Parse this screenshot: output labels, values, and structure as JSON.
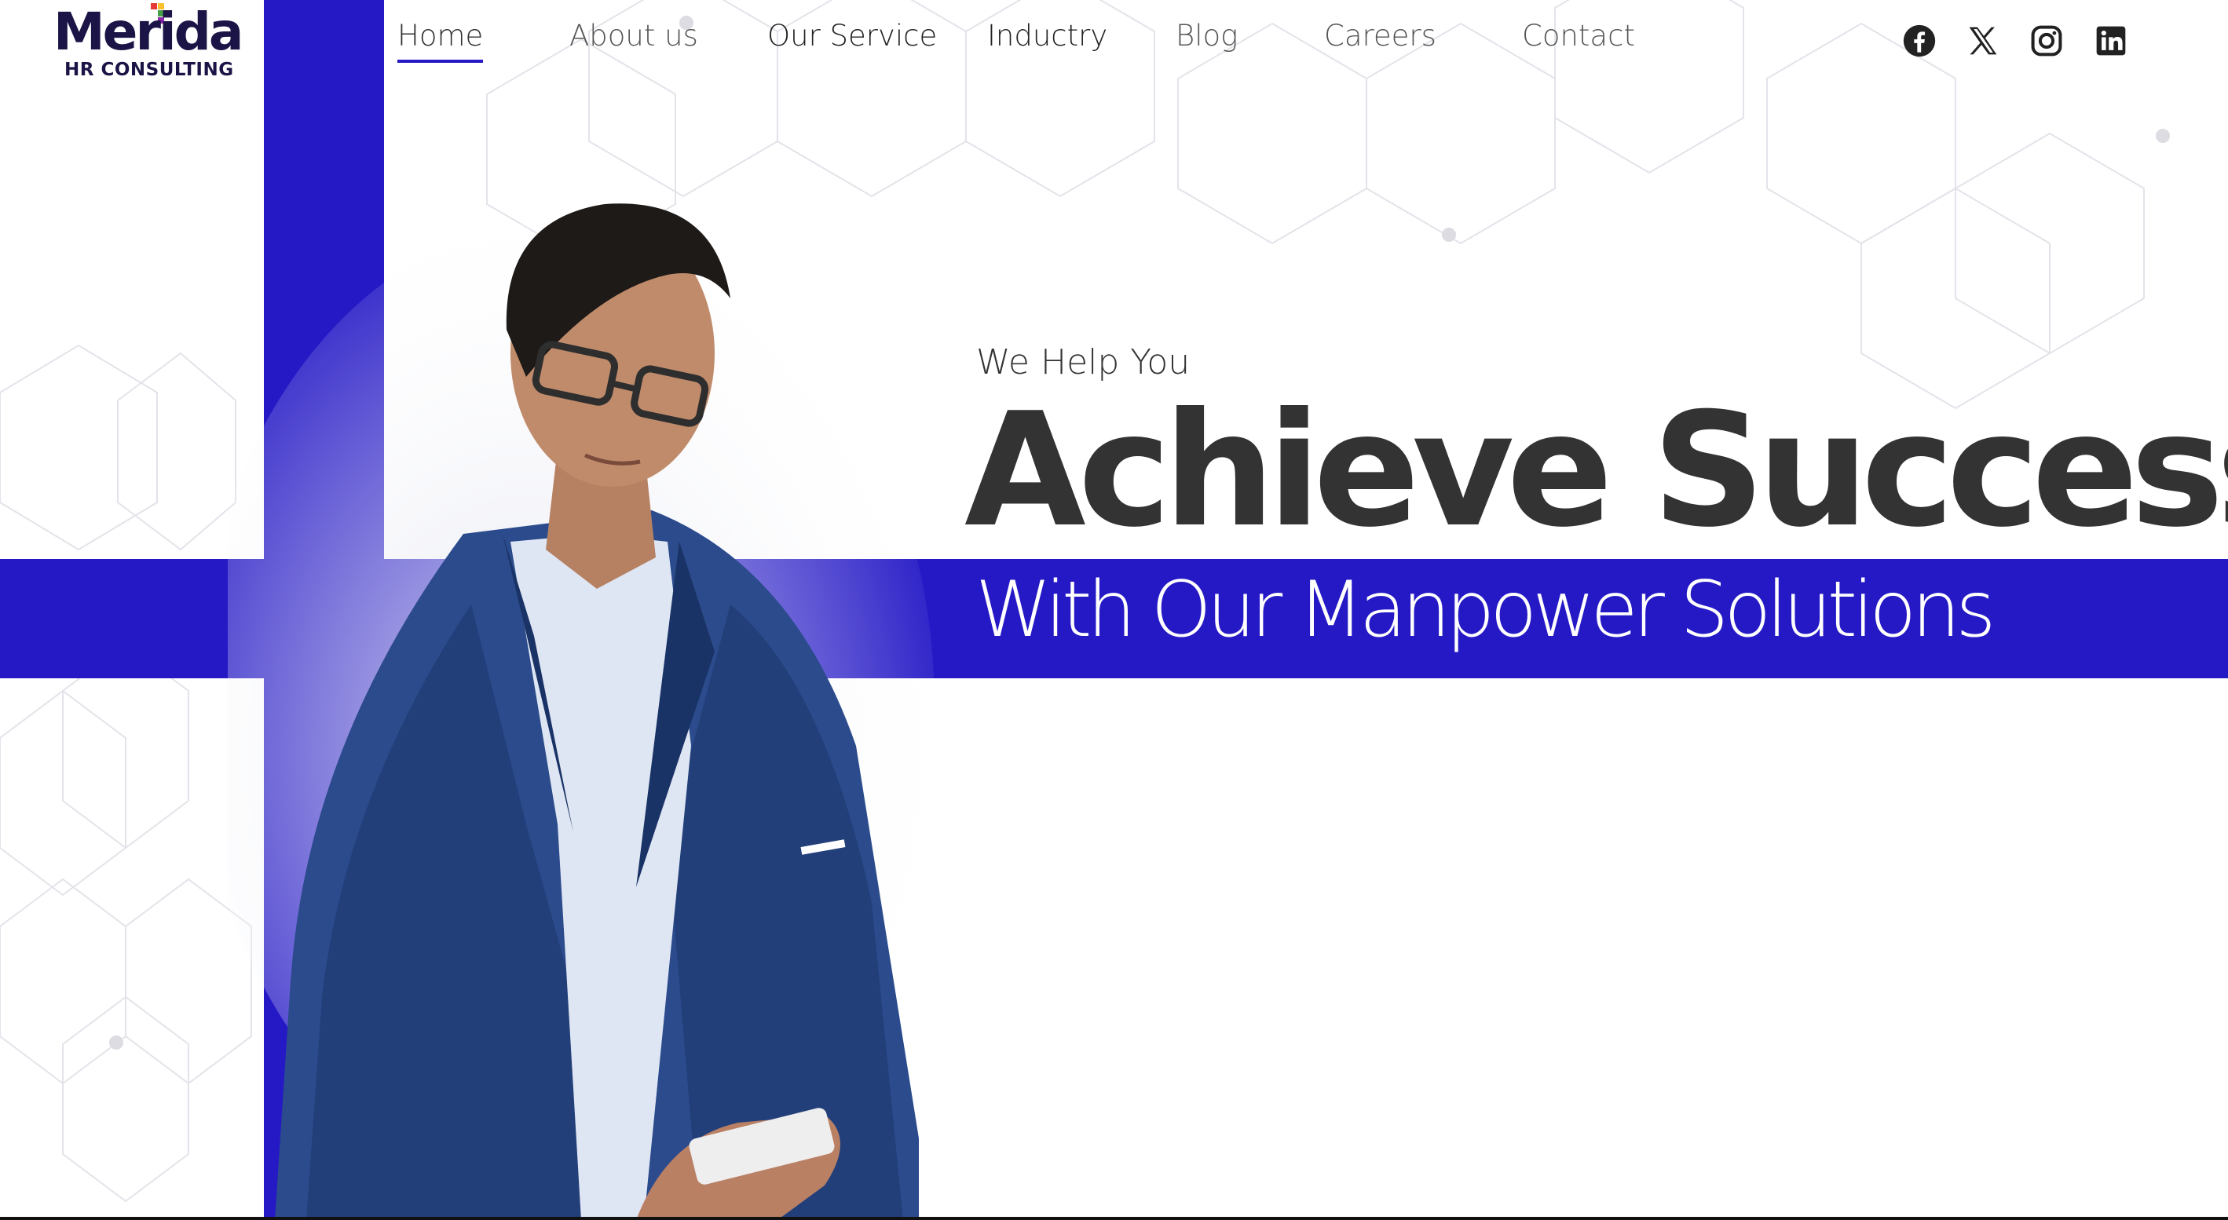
{
  "brand": {
    "name": "Merida",
    "tagline": "HR CONSULTING",
    "accent_color": "#2519c6",
    "dark_color": "#1b1446"
  },
  "nav": {
    "items": [
      {
        "label": "Home",
        "active": true
      },
      {
        "label": "About us",
        "active": false
      },
      {
        "label": "Our Service",
        "active": false
      },
      {
        "label": "Inductry",
        "active": false
      },
      {
        "label": "Blog",
        "active": false
      },
      {
        "label": "Careers",
        "active": false
      },
      {
        "label": "Contact",
        "active": false
      }
    ]
  },
  "social": {
    "icons": [
      "facebook-icon",
      "x-twitter-icon",
      "instagram-icon",
      "linkedin-icon"
    ]
  },
  "hero": {
    "eyebrow": "We Help You",
    "headline": "Achieve Success",
    "subheadline": "With Our Manpower Solutions"
  }
}
